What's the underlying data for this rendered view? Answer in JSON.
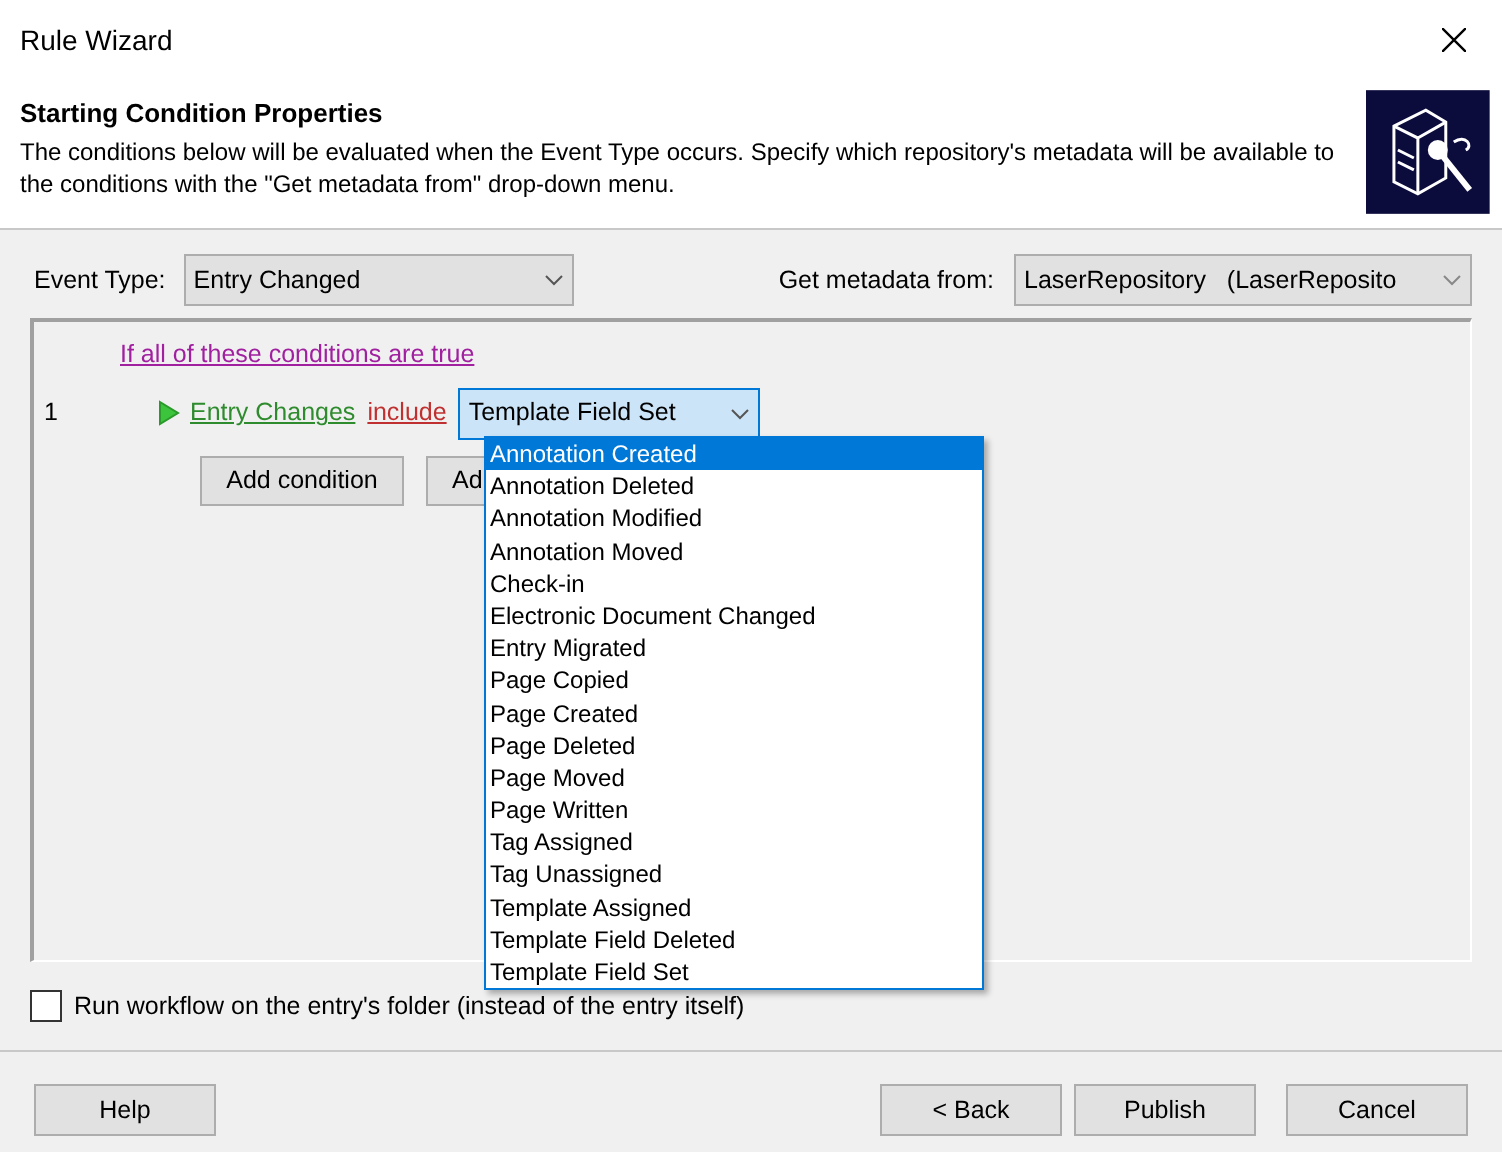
{
  "window": {
    "title": "Rule Wizard"
  },
  "header": {
    "title": "Starting Condition Properties",
    "description": "The conditions below will be evaluated when the Event Type occurs. Specify which repository's metadata will be available to the conditions with the \"Get metadata from\" drop-down menu."
  },
  "event_type": {
    "label": "Event Type:",
    "value": "Entry Changed"
  },
  "metadata": {
    "label": "Get metadata from:",
    "value": "LaserRepository   (LaserReposito"
  },
  "conditions_link": "If all of these conditions are true",
  "condition": {
    "number": "1",
    "field": "Entry Changes",
    "operator": "include",
    "value": "Template Field Set"
  },
  "condition_buttons": [
    "Add condition",
    "Ad"
  ],
  "dropdown_options": [
    {
      "label": "Annotation Created",
      "selected": true
    },
    {
      "label": "Annotation Deleted",
      "selected": false
    },
    {
      "label": "Annotation Modified",
      "selected": false
    },
    {
      "label": "Annotation Moved",
      "selected": false
    },
    {
      "label": "Check-in",
      "selected": false
    },
    {
      "label": "Electronic Document Changed",
      "selected": false
    },
    {
      "label": "Entry Migrated",
      "selected": false
    },
    {
      "label": "Page Copied",
      "selected": false
    },
    {
      "label": "Page Created",
      "selected": false
    },
    {
      "label": "Page Deleted",
      "selected": false
    },
    {
      "label": "Page Moved",
      "selected": false
    },
    {
      "label": "Page Written",
      "selected": false
    },
    {
      "label": "Tag Assigned",
      "selected": false
    },
    {
      "label": "Tag Unassigned",
      "selected": false
    },
    {
      "label": "Template Assigned",
      "selected": false
    },
    {
      "label": "Template Field Deleted",
      "selected": false
    },
    {
      "label": "Template Field Set",
      "selected": false
    }
  ],
  "folder_option": {
    "label": "Run workflow on the entry's folder (instead of the entry itself)",
    "checked": false
  },
  "footer_buttons": [
    {
      "label": "Help",
      "kind": "left"
    },
    {
      "label": "< Back",
      "kind": "right"
    },
    {
      "label": "Publish",
      "kind": "right"
    },
    {
      "label": "Cancel",
      "kind": "right"
    }
  ]
}
